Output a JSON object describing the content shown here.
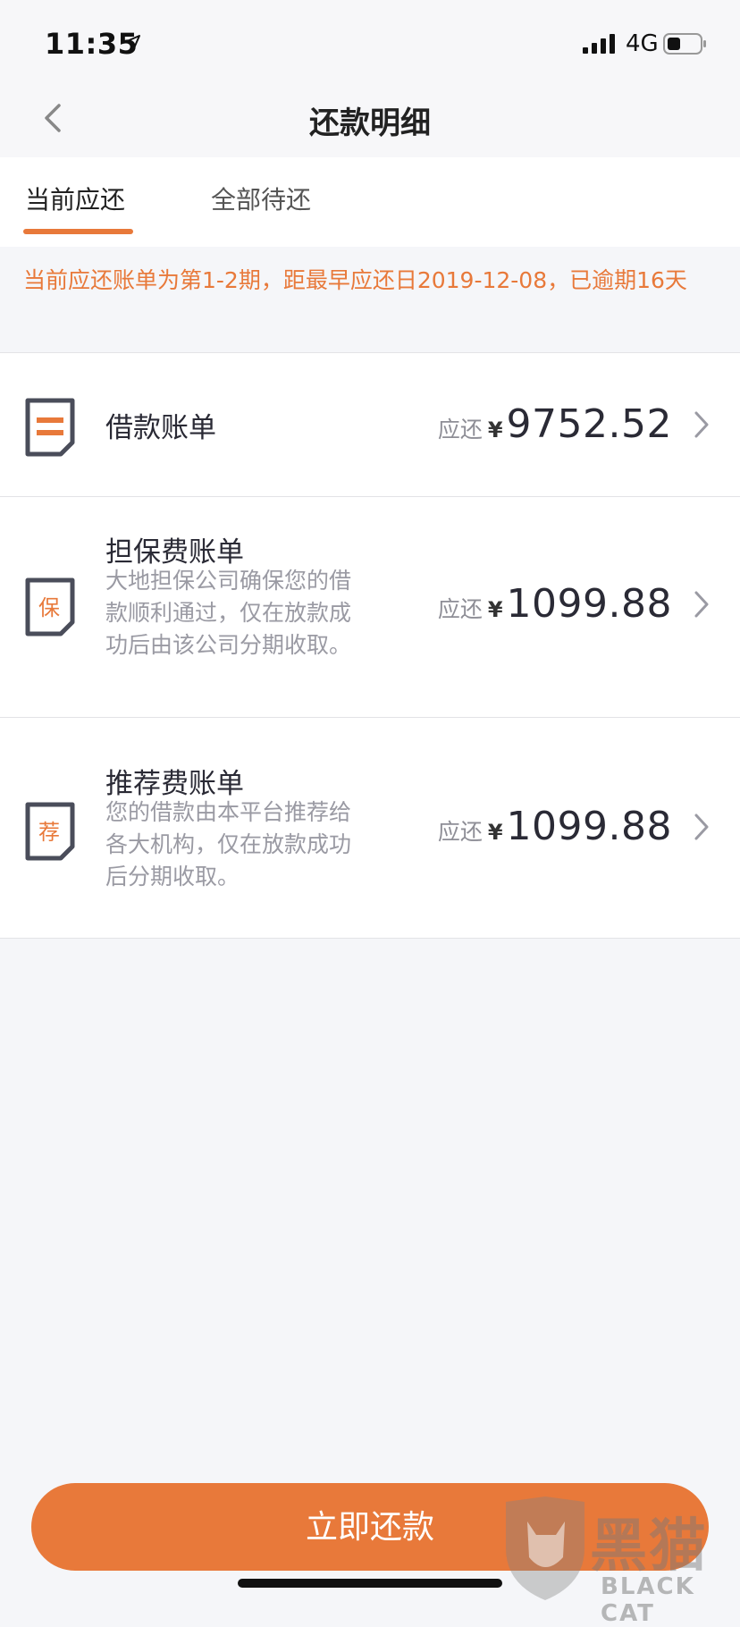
{
  "status_bar": {
    "time": "11:35",
    "network": "4G"
  },
  "nav": {
    "title": "还款明细"
  },
  "tabs": [
    {
      "label": "当前应还",
      "active": true
    },
    {
      "label": "全部待还",
      "active": false
    }
  ],
  "notice": {
    "text": "当前应还账单为第1-2期，距最早应还日2019-12-08，已逾期16天"
  },
  "bills": [
    {
      "icon_char": "",
      "name": "借款账单",
      "description": "",
      "due_label": "应还",
      "currency": "¥",
      "amount": "9752.52"
    },
    {
      "icon_char": "保",
      "name": "担保费账单",
      "description": "大地担保公司确保您的借款顺利通过，仅在放款成功后由该公司分期收取。",
      "due_label": "应还",
      "currency": "¥",
      "amount": "1099.88"
    },
    {
      "icon_char": "荐",
      "name": "推荐费账单",
      "description": "您的借款由本平台推荐给各大机构，仅在放款成功后分期收取。",
      "due_label": "应还",
      "currency": "¥",
      "amount": "1099.88"
    }
  ],
  "pay_button": {
    "label": "立即还款"
  },
  "watermark": {
    "main": "黑猫",
    "sub": "BLACK CAT"
  },
  "colors": {
    "accent": "#e8793a",
    "icon_border": "#4a4d5a",
    "background": "#f5f6f9"
  }
}
